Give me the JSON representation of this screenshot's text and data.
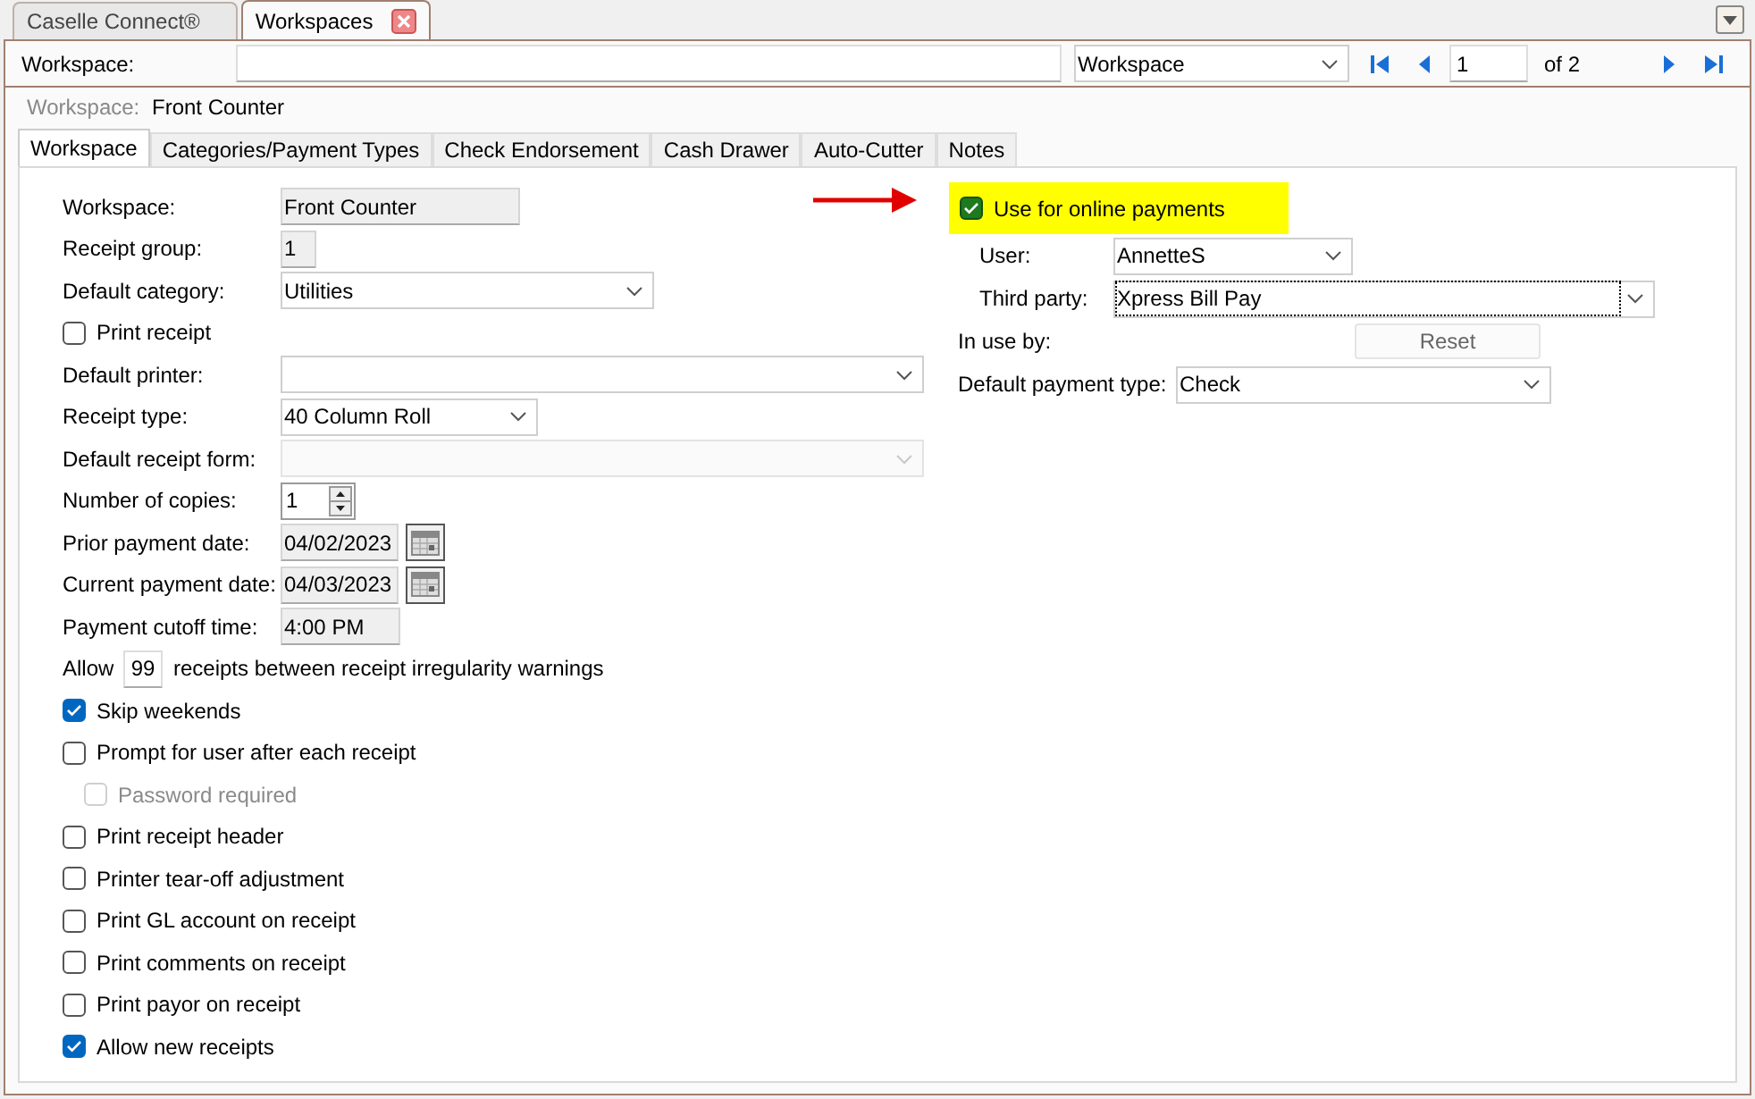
{
  "doc_tabs": [
    {
      "label": "Caselle Connect®",
      "selected": false,
      "closable": false
    },
    {
      "label": "Workspaces",
      "selected": true,
      "closable": true
    }
  ],
  "toolbar": {
    "label": "Workspace:",
    "view_select": "Workspace",
    "page": "1",
    "page_of": "of 2"
  },
  "record": {
    "label": "Workspace:",
    "value": "Front Counter"
  },
  "tabs": [
    {
      "label": "Workspace",
      "selected": true
    },
    {
      "label": "Categories/Payment Types",
      "selected": false
    },
    {
      "label": "Check Endorsement",
      "selected": false
    },
    {
      "label": "Cash Drawer",
      "selected": false
    },
    {
      "label": "Auto-Cutter",
      "selected": false
    },
    {
      "label": "Notes",
      "selected": false
    }
  ],
  "left": [
    {
      "kind": "text",
      "label": "Workspace:",
      "value": "Front Counter"
    },
    {
      "kind": "text",
      "label": "Receipt group:",
      "value": "1"
    },
    {
      "kind": "select",
      "label": "Default category:",
      "value": "Utilities"
    },
    {
      "kind": "checkbox",
      "label": "Print receipt",
      "checked": false
    },
    {
      "kind": "select",
      "label": "Default printer:"
    },
    {
      "kind": "select",
      "label": "Receipt type:",
      "value": "40 Column Roll"
    },
    {
      "kind": "select",
      "label": "Default receipt form:",
      "disabled": true
    },
    {
      "kind": "spinner",
      "label": "Number of copies:",
      "value": "1"
    },
    {
      "kind": "date",
      "label": "Prior payment date:",
      "value": "04/02/2023"
    },
    {
      "kind": "date",
      "label": "Current payment date:",
      "value": "04/03/2023"
    },
    {
      "kind": "text",
      "label": "Payment cutoff time:",
      "value": "4:00 PM"
    },
    {
      "kind": "allow",
      "label": "Allow",
      "value": "99",
      "suffix": "receipts between receipt irregularity warnings"
    },
    {
      "kind": "checkbox",
      "label": "Skip weekends",
      "checked": true
    },
    {
      "kind": "checkbox",
      "label": "Prompt for user after each receipt",
      "checked": false,
      "children": [
        {
          "kind": "checkbox",
          "label": "Password required",
          "checked": false,
          "disabled": true
        }
      ]
    },
    {
      "kind": "checkbox",
      "label": "Print receipt header",
      "checked": false
    },
    {
      "kind": "checkbox",
      "label": "Printer tear-off adjustment",
      "checked": false
    },
    {
      "kind": "checkbox",
      "label": "Print GL account on receipt",
      "checked": false
    },
    {
      "kind": "checkbox",
      "label": "Print comments on receipt",
      "checked": false
    },
    {
      "kind": "checkbox",
      "label": "Print payor on receipt",
      "checked": false
    },
    {
      "kind": "checkbox",
      "label": "Allow new receipts",
      "checked": true
    }
  ],
  "online": {
    "label": "Use for online payments",
    "checked": true,
    "highlighted": true,
    "user": {
      "label": "User:",
      "value": "AnnetteS"
    },
    "third_party": {
      "label": "Third party:",
      "value": "Xpress Bill Pay",
      "focused": true
    },
    "in_use": {
      "label": "In use by:",
      "button": "Reset"
    },
    "payment_type": {
      "label": "Default payment type:",
      "value": "Check"
    }
  }
}
